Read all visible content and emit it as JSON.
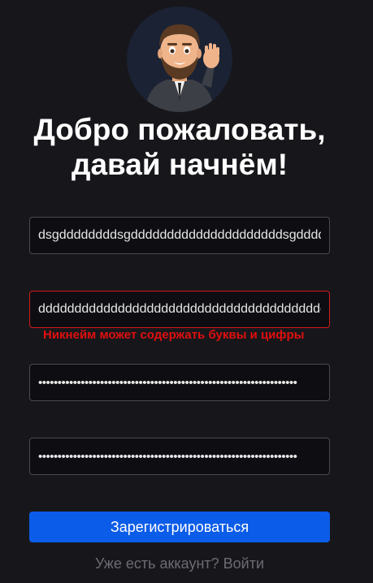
{
  "header": {
    "title_line1": "Добро пожаловать,",
    "title_line2": "давай начнём!"
  },
  "form": {
    "email_value": "dsgddddddddsgdddddddddddddddddddddsgddddddd",
    "nickname_value": "dddddddddddddddddddddddddddddddddddddddddddd",
    "nickname_error": "Никнейм может содержать буквы и цифры",
    "password_value": "•••••••••••••••••••••••••••••••••••••••••••••••••••••••••••••••••••",
    "confirm_password_value": "•••••••••••••••••••••••••••••••••••••••••••••••••••••••••••••••••••",
    "submit_label": "Зарегистрироваться",
    "login_link": "Уже есть аккаунт? Войти"
  },
  "colors": {
    "background": "#17171b",
    "accent": "#0b5ce8",
    "error": "#e00f0f"
  },
  "icons": {
    "avatar": "waving-man-avatar"
  }
}
